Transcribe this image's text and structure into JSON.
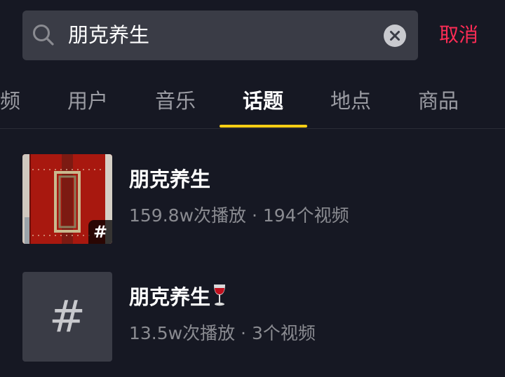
{
  "search": {
    "query": "朋克养生",
    "cancel_label": "取消"
  },
  "tabs": [
    {
      "label": "频"
    },
    {
      "label": "用户"
    },
    {
      "label": "音乐"
    },
    {
      "label": "话题",
      "active": true
    },
    {
      "label": "地点"
    },
    {
      "label": "商品"
    }
  ],
  "results": [
    {
      "title": "朋克养生",
      "meta": "159.8w次播放 · 194个视频",
      "thumb": "photo",
      "badge": "#"
    },
    {
      "title": "朋克养生",
      "title_emoji_icon": "wine-glass-icon",
      "meta": "13.5w次播放 · 3个视频",
      "thumb": "hash-placeholder",
      "placeholder_glyph": "#"
    }
  ],
  "colors": {
    "background": "#161823",
    "accent_cancel": "#fe2c55",
    "tab_indicator": "#face15",
    "search_box": "#3a3c46"
  }
}
